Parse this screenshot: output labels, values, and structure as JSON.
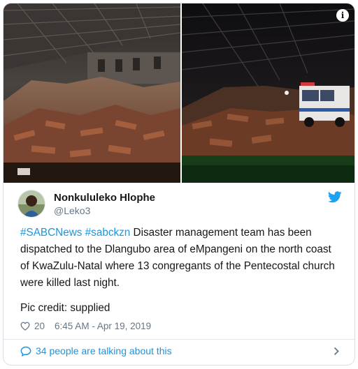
{
  "tweet": {
    "author": {
      "display_name": "Nonkululeko Hlophe",
      "handle": "@Leko3"
    },
    "text": {
      "hashtag1": "#SABCNews",
      "hashtag2": "#sabckzn",
      "body": " Disaster management team has been dispatched to the Dlangubo area of eMpangeni on the north coast of KwaZulu-Natal where 13 congregants of the Pentecostal church were killed last night."
    },
    "credit": "Pic credit: supplied",
    "likes": "20",
    "timestamp": "6:45 AM - Apr 19, 2019",
    "talking": "34 people are talking about this"
  },
  "icons": {
    "info": "info-icon",
    "bird": "twitter-bird-icon",
    "heart": "heart-icon",
    "comment": "comment-bubble-icon",
    "chevron": "chevron-right-icon"
  },
  "colors": {
    "link": "#1b95e0",
    "text": "#14171a",
    "muted": "#657786",
    "border": "#e1e8ed"
  }
}
